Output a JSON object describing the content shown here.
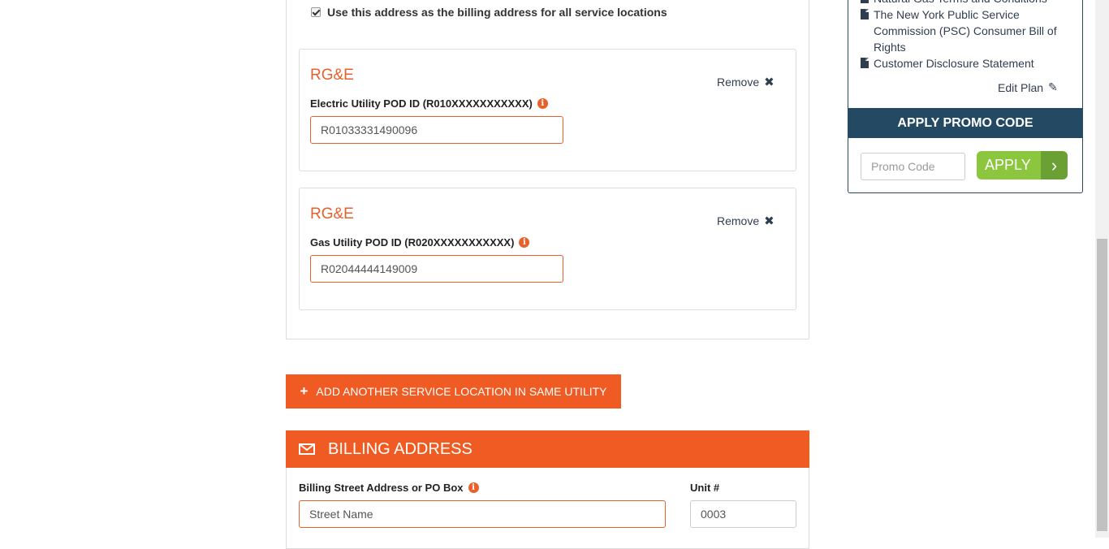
{
  "service": {
    "billing_checkbox_label": "Use this address as the billing address for all service locations",
    "cards": [
      {
        "utility": "RG&E",
        "remove_label": "Remove",
        "field_label": "Electric Utility POD ID (R010XXXXXXXXXXX)",
        "value": "R01033331490096"
      },
      {
        "utility": "RG&E",
        "remove_label": "Remove",
        "field_label": "Gas Utility POD ID (R020XXXXXXXXXXX)",
        "value": "R02044444149009"
      }
    ],
    "add_button_label": "ADD ANOTHER SERVICE LOCATION IN SAME UTILITY"
  },
  "billing": {
    "title": "BILLING ADDRESS",
    "street_label": "Billing Street Address or PO Box",
    "street_placeholder": "Street Name",
    "unit_label": "Unit #",
    "unit_value": "0003"
  },
  "sidebar": {
    "documents": [
      "Natural Gas Terms and Conditions",
      "The New York Public Service Commission (PSC) Consumer Bill of Rights",
      "Customer Disclosure Statement"
    ],
    "edit_plan_label": "Edit Plan",
    "promo_title": "APPLY PROMO CODE",
    "promo_placeholder": "Promo Code",
    "apply_label": "APPLY"
  },
  "colors": {
    "accent_orange": "#ef5b22",
    "navy": "#244a63",
    "apply_green": "#8cc63f"
  },
  "icons": {
    "checkbox": "checkmark-icon",
    "info": "info-icon",
    "remove": "close-icon",
    "add": "plus-icon",
    "billing": "envelope-icon",
    "document": "document-icon",
    "edit": "pencil-icon",
    "apply": "chevron-right-icon"
  }
}
